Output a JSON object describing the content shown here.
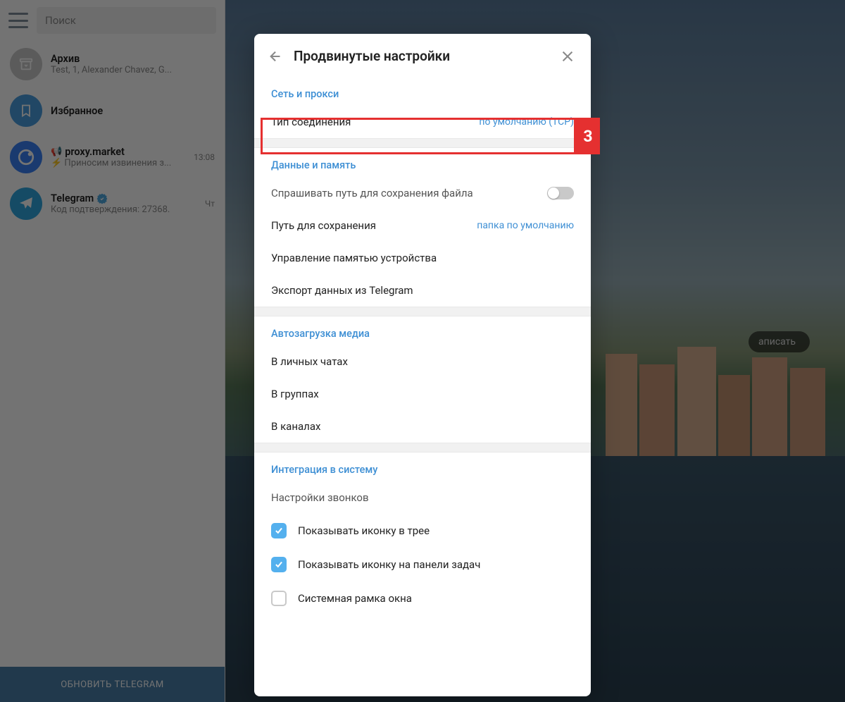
{
  "sidebar": {
    "search_placeholder": "Поиск",
    "chats": [
      {
        "title": "Архив",
        "subtitle": "Test, 1, Alexander Chavez, G..."
      },
      {
        "title": "Избранное",
        "subtitle": ""
      },
      {
        "title": "proxy.market",
        "subtitle": "Приносим извинения з...",
        "time": "13:08",
        "megaphone": true,
        "bolt": true
      },
      {
        "title": "Telegram",
        "subtitle": "Код подтверждения: 27368.",
        "time": "Чт",
        "verified": true
      }
    ],
    "update_button": "ОБНОВИТЬ TELEGRAM"
  },
  "background": {
    "write_label": "аписать"
  },
  "modal": {
    "title": "Продвинутые настройки",
    "sections": {
      "network": {
        "title": "Сеть и прокси",
        "connection_type_label": "Тип соединения",
        "connection_type_value": "по умолчанию (TCP)"
      },
      "data": {
        "title": "Данные и память",
        "ask_path": "Спрашивать путь для сохранения файла",
        "save_path_label": "Путь для сохранения",
        "save_path_value": "папка по умолчанию",
        "manage_memory": "Управление памятью устройства",
        "export": "Экспорт данных из Telegram"
      },
      "autoload": {
        "title": "Автозагрузка медиа",
        "private": "В личных чатах",
        "groups": "В группах",
        "channels": "В каналах"
      },
      "system": {
        "title": "Интеграция в систему",
        "call_settings": "Настройки звонков",
        "tray_icon": "Показывать иконку в трее",
        "taskbar_icon": "Показывать иконку на панели задач",
        "native_frame": "Системная рамка окна"
      }
    }
  },
  "annotation": {
    "badge": "3"
  }
}
